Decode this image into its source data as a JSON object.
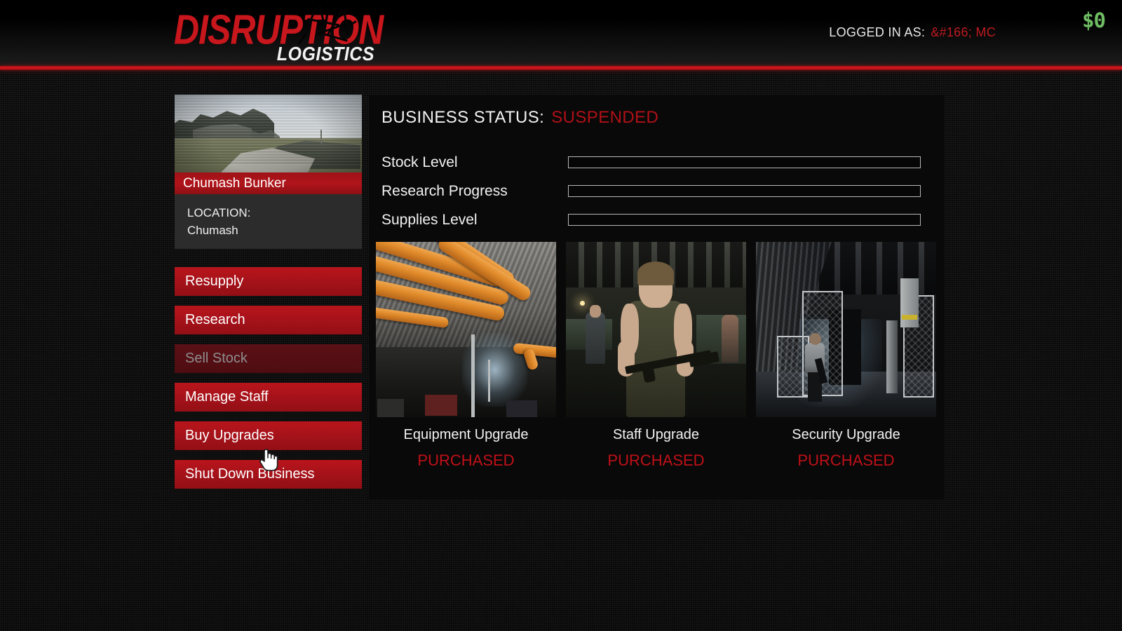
{
  "header": {
    "logo_main": "DISRUPTION",
    "logo_sub": "LOGISTICS",
    "logged_in_label": "LOGGED IN AS:",
    "logged_in_user": "&#166; MC",
    "money": "$0"
  },
  "property": {
    "name": "Chumash Bunker",
    "location_label": "LOCATION:",
    "location_value": "Chumash"
  },
  "menu": {
    "items": [
      {
        "label": "Resupply",
        "disabled": false
      },
      {
        "label": "Research",
        "disabled": false
      },
      {
        "label": "Sell Stock",
        "disabled": true
      },
      {
        "label": "Manage Staff",
        "disabled": false
      },
      {
        "label": "Buy Upgrades",
        "disabled": false
      },
      {
        "label": "Shut Down Business",
        "disabled": false
      }
    ]
  },
  "status": {
    "label": "BUSINESS STATUS:",
    "value": "SUSPENDED",
    "value_color": "#b01017"
  },
  "meters": [
    {
      "label": "Stock Level",
      "percent": 0
    },
    {
      "label": "Research Progress",
      "percent": 0
    },
    {
      "label": "Supplies Level",
      "percent": 0
    }
  ],
  "upgrades": [
    {
      "title": "Equipment Upgrade",
      "state": "PURCHASED",
      "image": "bunker-pipes-workshop"
    },
    {
      "title": "Staff Upgrade",
      "state": "PURCHASED",
      "image": "worker-assembling-rifle"
    },
    {
      "title": "Security Upgrade",
      "state": "PURCHASED",
      "image": "guarded-bunker-tunnel"
    }
  ],
  "cursor": {
    "type": "pointing-hand"
  }
}
